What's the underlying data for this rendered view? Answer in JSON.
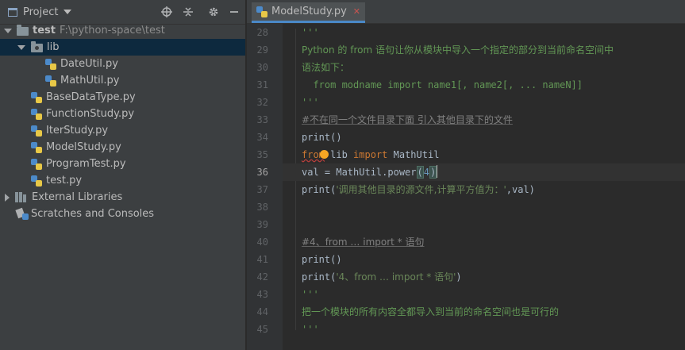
{
  "project_panel": {
    "title": "Project",
    "tree": [
      {
        "label": "test",
        "sublabel": "F:\\python-space\\test",
        "type": "folder-root"
      },
      {
        "label": "lib",
        "type": "folder"
      },
      {
        "label": "DateUtil.py",
        "type": "py"
      },
      {
        "label": "MathUtil.py",
        "type": "py"
      },
      {
        "label": "BaseDataType.py",
        "type": "py"
      },
      {
        "label": "FunctionStudy.py",
        "type": "py"
      },
      {
        "label": "IterStudy.py",
        "type": "py"
      },
      {
        "label": "ModelStudy.py",
        "type": "py"
      },
      {
        "label": "ProgramTest.py",
        "type": "py"
      },
      {
        "label": "test.py",
        "type": "py"
      },
      {
        "label": "External Libraries",
        "type": "libs"
      },
      {
        "label": "Scratches and Consoles",
        "type": "scratch"
      }
    ]
  },
  "editor": {
    "tab_label": "ModelStudy.py",
    "current_line": "36",
    "lines": [
      {
        "num": "28",
        "text": "'''"
      },
      {
        "num": "29",
        "text": "Python 的 from 语句让你从模块中导入一个指定的部分到当前命名空间中"
      },
      {
        "num": "30",
        "text": "语法如下："
      },
      {
        "num": "31",
        "text": "  from modname import name1[, name2[, ... nameN]]"
      },
      {
        "num": "32",
        "text": "'''"
      },
      {
        "num": "33",
        "text": "#不在同一个文件目录下面 引入其他目录下的文件"
      },
      {
        "num": "34",
        "text": "print()"
      },
      {
        "num": "35",
        "kw1": "from",
        "mid": " lib ",
        "kw2": "import",
        "tail": " MathUtil"
      },
      {
        "num": "36",
        "pre": "val = MathUtil.power",
        "paren_open": "(",
        "arg": "4",
        "paren_close": ")"
      },
      {
        "num": "37",
        "pre": "print(",
        "str": "'调用其他目录的源文件,计算平方值为：'",
        "tail": ",val)"
      },
      {
        "num": "38",
        "text": ""
      },
      {
        "num": "39",
        "text": ""
      },
      {
        "num": "40",
        "text": "#4、from … import * 语句"
      },
      {
        "num": "41",
        "text": "print()"
      },
      {
        "num": "42",
        "pre": "print(",
        "str": "'4、from … import * 语句'",
        "tail": ")"
      },
      {
        "num": "43",
        "text": "'''"
      },
      {
        "num": "44",
        "text": "把一个模块的所有内容全都导入到当前的命名空间也是可行的"
      },
      {
        "num": "45",
        "text": "'''"
      }
    ]
  }
}
